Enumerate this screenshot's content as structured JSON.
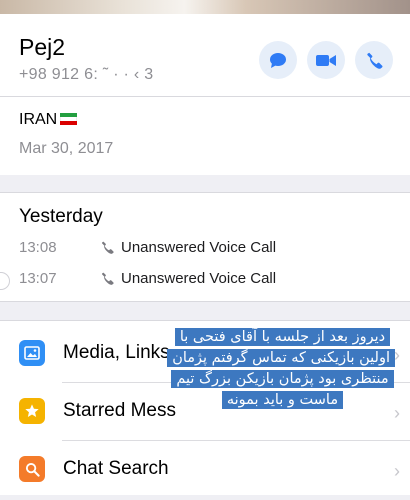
{
  "contact": {
    "name": "Pej2",
    "phone_masked": "+98 912 6: ˜ · · ‹ 3",
    "actions": [
      {
        "name": "message",
        "icon": "chat-bubble-icon"
      },
      {
        "name": "video",
        "icon": "video-camera-icon"
      },
      {
        "name": "call",
        "icon": "phone-icon"
      }
    ]
  },
  "info": {
    "country": "IRAN",
    "flag_icon": "iran-flag-icon",
    "date": "Mar 30, 2017"
  },
  "calls": {
    "header": "Yesterday",
    "items": [
      {
        "time": "13:08",
        "label": "Unanswered Voice Call"
      },
      {
        "time": "13:07",
        "label": "Unanswered Voice Call"
      }
    ]
  },
  "menu": {
    "items": [
      {
        "label": "Media, Links",
        "icon": "photo-icon",
        "color": "#2f8ff5"
      },
      {
        "label": "Starred Mess",
        "icon": "star-icon",
        "color": "#f5b300"
      },
      {
        "label": "Chat Search",
        "icon": "search-icon",
        "color": "#f47b2a"
      }
    ]
  },
  "overlay_text": "دیروز بعد از جلسه با آقای فتحی با اولین بازیکنی که تماس گرفتم پژمان منتظری بود پژمان بازیکن بزرگ تیم ماست و باید بمونه",
  "colors": {
    "accent": "#2f7bf5",
    "action_bg": "#e6eef9",
    "overlay_bg": "#3d78c0",
    "secondary_text": "#8e8e93"
  }
}
